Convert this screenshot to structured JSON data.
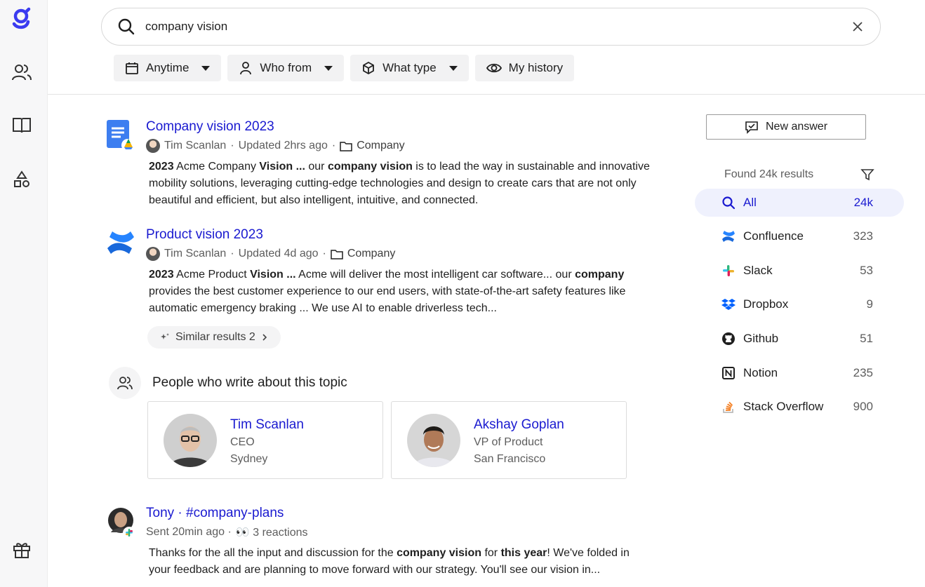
{
  "search": {
    "value": "company vision"
  },
  "filters": [
    {
      "label": "Anytime",
      "icon": "calendar-icon"
    },
    {
      "label": "Who from",
      "icon": "person-icon"
    },
    {
      "label": "What type",
      "icon": "cube-icon"
    },
    {
      "label": "My history",
      "icon": "eye-icon"
    }
  ],
  "results": [
    {
      "title": "Company vision 2023",
      "author": "Tim Scanlan",
      "updated": "Updated 2hrs ago",
      "folder": "Company",
      "snippet_parts": [
        "2023",
        " Acme Company ",
        "Vision ...",
        " our ",
        "company vision",
        " is to lead the way in sustainable and innovative mobility solutions, leveraging cutting-edge technologies and design to create cars that are not only beautiful and efficient, but also intelligent, intuitive, and connected."
      ]
    },
    {
      "title": "Product vision 2023",
      "author": "Tim Scanlan",
      "updated": "Updated 4d ago",
      "folder": "Company",
      "snippet_parts": [
        "2023",
        " Acme Product ",
        "Vision ...",
        " Acme will deliver the most intelligent car software... our ",
        "company",
        " provides the best customer experience to our end users, with state-of-the-art safety features like automatic emergency braking ... We use AI to enable driverless tech..."
      ]
    },
    {
      "title": "Tony · #company-plans",
      "sent": "Sent 20min ago ·",
      "reactions": "👀 3 reactions",
      "snippet_parts": [
        "Thanks for the all the input and discussion for the ",
        "company vision",
        " for ",
        "this year",
        "! We've folded in your feedback and are planning to move forward with our strategy. You'll see our vision in..."
      ]
    }
  ],
  "similar": {
    "label": "Similar results 2"
  },
  "people": {
    "heading": "People who write about this topic",
    "cards": [
      {
        "name": "Tim Scanlan",
        "role": "CEO",
        "location": "Sydney"
      },
      {
        "name": "Akshay Goplan",
        "role": "VP of Product",
        "location": "San Francisco"
      }
    ]
  },
  "right_panel": {
    "new_answer": "New answer",
    "found": "Found 24k results",
    "sources": [
      {
        "label": "All",
        "count": "24k",
        "icon": "search-icon",
        "active": true
      },
      {
        "label": "Confluence",
        "count": "323",
        "icon": "confluence-icon"
      },
      {
        "label": "Slack",
        "count": "53",
        "icon": "slack-icon"
      },
      {
        "label": "Dropbox",
        "count": "9",
        "icon": "dropbox-icon"
      },
      {
        "label": "Github",
        "count": "51",
        "icon": "github-icon"
      },
      {
        "label": "Notion",
        "count": "235",
        "icon": "notion-icon"
      },
      {
        "label": "Stack Overflow",
        "count": "900",
        "icon": "stackoverflow-icon"
      }
    ]
  },
  "colors": {
    "accent": "#1a1ad0",
    "logo": "#3b3bf0"
  }
}
